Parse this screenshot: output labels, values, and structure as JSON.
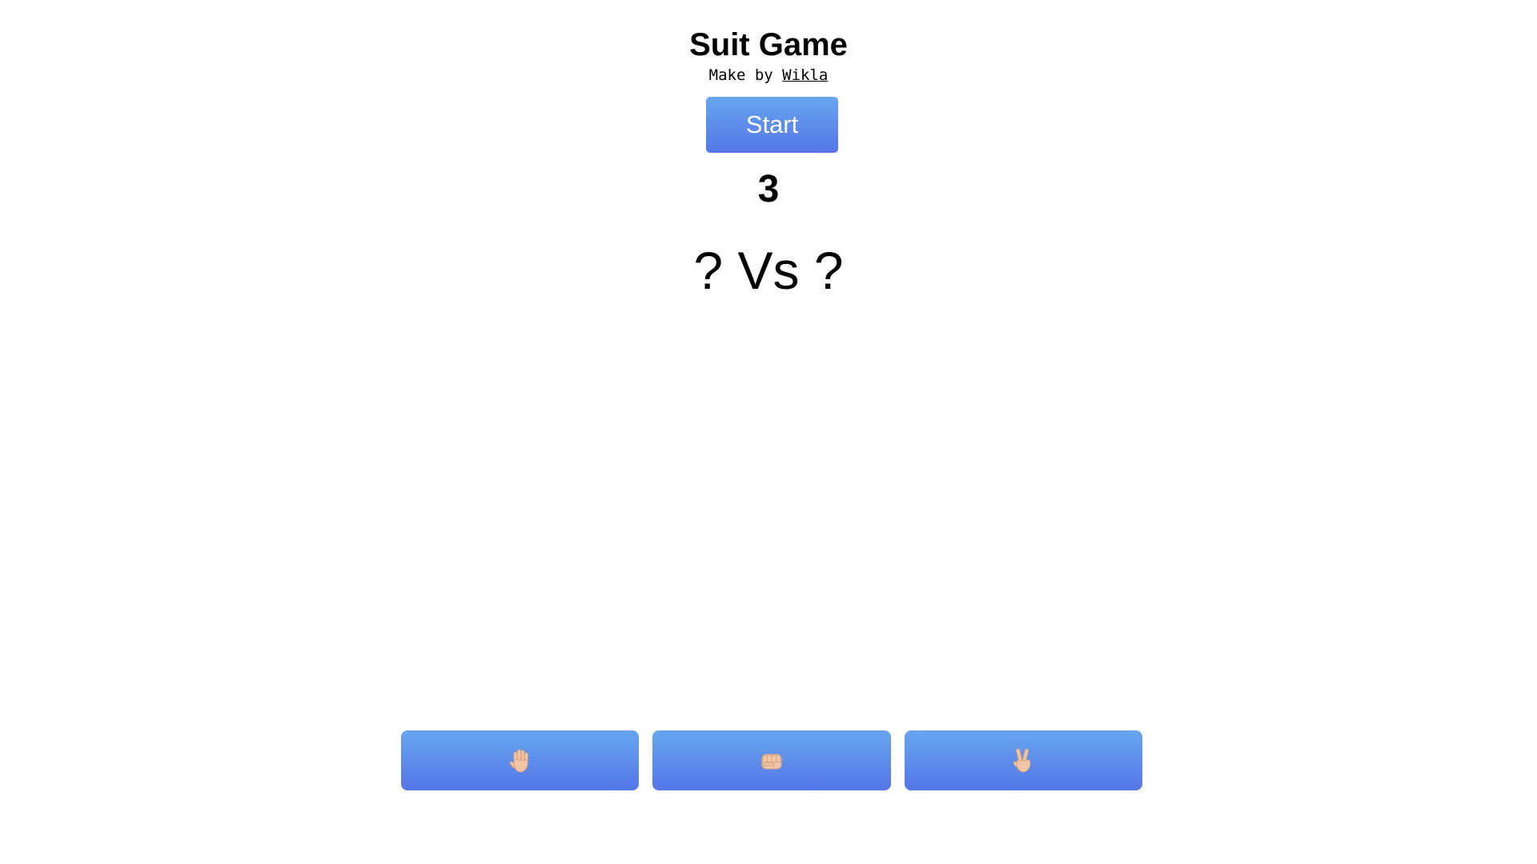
{
  "header": {
    "title": "Suit Game",
    "credit_prefix": "Make by ",
    "credit_author": "Wikla"
  },
  "controls": {
    "start_label": "Start"
  },
  "game": {
    "countdown": "3",
    "player_choice": "?",
    "versus_label": "Vs",
    "computer_choice": "?"
  },
  "choices": [
    {
      "name": "paper",
      "icon": "raised-hand-icon"
    },
    {
      "name": "rock",
      "icon": "fist-icon"
    },
    {
      "name": "scissors",
      "icon": "victory-hand-icon"
    }
  ],
  "colors": {
    "button_gradient_top": "#66a6ee",
    "button_gradient_bottom": "#5576e8",
    "skin_tone": "#f1c6a6"
  }
}
